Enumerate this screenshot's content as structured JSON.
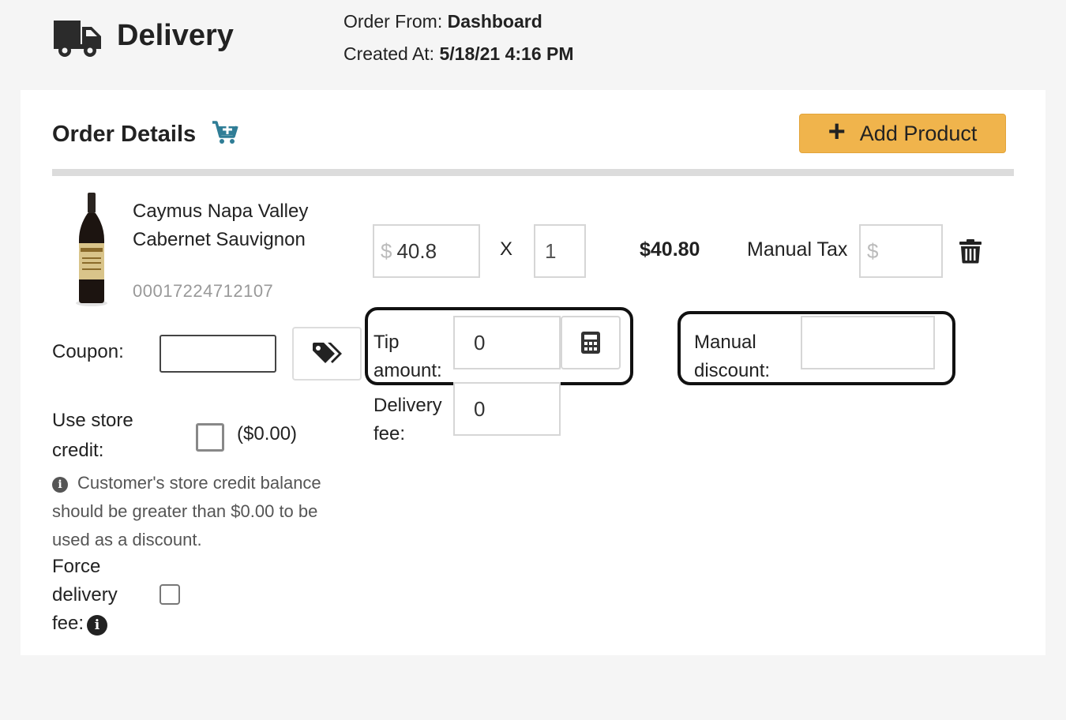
{
  "header": {
    "title": "Delivery",
    "order_from_label": "Order From:",
    "order_from_value": "Dashboard",
    "created_at_label": "Created At:",
    "created_at_value": "5/18/21 4:16 PM",
    "icon": "truck-icon"
  },
  "order_details": {
    "title": "Order Details",
    "cart_icon": "cart-plus-icon",
    "add_product_label": "Add Product"
  },
  "product": {
    "name": "Caymus Napa Valley Cabernet Sauvignon",
    "sku": "00017224712107",
    "currency_symbol": "$",
    "price": "40.8",
    "times": "X",
    "quantity": "1",
    "line_total": "$40.80",
    "manual_tax_label": "Manual Tax",
    "manual_tax_placeholder": "$"
  },
  "coupon": {
    "label": "Coupon:",
    "value": ""
  },
  "tip": {
    "label": "Tip amount:",
    "value": "0"
  },
  "manual_discount": {
    "label": "Manual discount:",
    "value": ""
  },
  "delivery_fee": {
    "label": "Delivery fee:",
    "value": "0"
  },
  "store_credit": {
    "label": "Use store credit:",
    "amount": "($0.00)",
    "checked": false,
    "note": "Customer's store credit balance should be greater than $0.00 to be used as a discount."
  },
  "force_delivery_fee": {
    "label": "Force delivery fee:",
    "checked": false
  },
  "colors": {
    "accent": "#f0b44c",
    "cart_icon": "#2f7d96",
    "highlight_border": "#111111"
  }
}
